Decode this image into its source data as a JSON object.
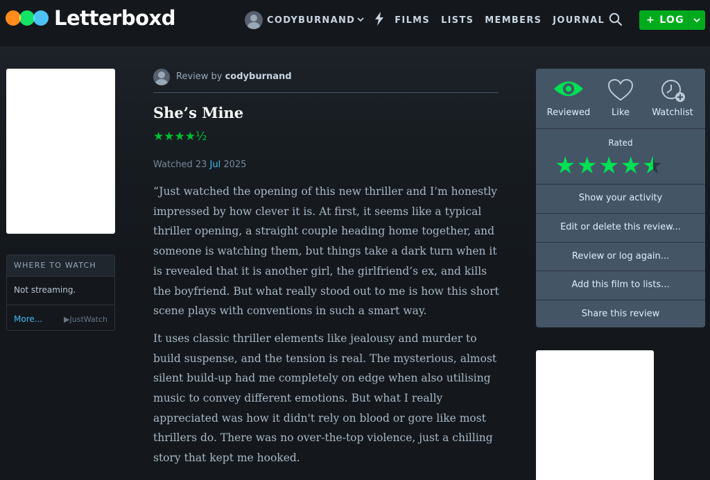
{
  "header": {
    "logo_text": "Letterboxd",
    "username": "CODYBURNAND",
    "nav_links": [
      "FILMS",
      "LISTS",
      "MEMBERS",
      "JOURNAL"
    ],
    "log_button": "+ LOG"
  },
  "where_to_watch": {
    "title": "WHERE TO WATCH",
    "status": "Not streaming.",
    "more": "More...",
    "provider": "▶JustWatch"
  },
  "review": {
    "by_prefix": "Review by ",
    "author": "codyburnand",
    "film_title": "She’s Mine",
    "rating": "★★★★½",
    "watched_prefix": "Watched 23 ",
    "watched_month": "Jul",
    "watched_year": " 2025",
    "paragraphs": [
      "“Just watched the opening of this new thriller and I’m honestly impressed by how clever it is. At first, it seems like a typical thriller opening, a straight couple heading home together, and someone is watching them, but things take a dark turn when it is revealed that it is another girl, the girlfriend’s ex, and kills the boyfriend. But what really stood out to me is how this short scene plays with conventions in such a smart way.",
      "It uses classic thriller elements like jealousy and murder to build suspense, and the tension is real. The mysterious, almost silent build-up had me completely on edge when also utilising music to convey different emotions. But what I really appreciated was how it didn't rely on blood or gore like most thrillers do. There was no over-the-top violence, just a chilling story that kept me hooked."
    ]
  },
  "panel": {
    "actions": [
      "Reviewed",
      "Like",
      "Watchlist"
    ],
    "rated_label": "Rated",
    "rated_value": 4.5,
    "rows": [
      "Show your activity",
      "Edit or delete this review...",
      "Review or log again...",
      "Add this film to lists...",
      "Share this review"
    ]
  },
  "colors": {
    "accent_green": "#00e054",
    "accent_orange": "#ff8000",
    "accent_blue": "#40bcf4",
    "log_button": "#00ac1c"
  },
  "icons": [
    "search-icon",
    "bolt-icon",
    "chevron-down-icon",
    "eye-icon",
    "heart-icon",
    "watchlist-clock-icon"
  ]
}
